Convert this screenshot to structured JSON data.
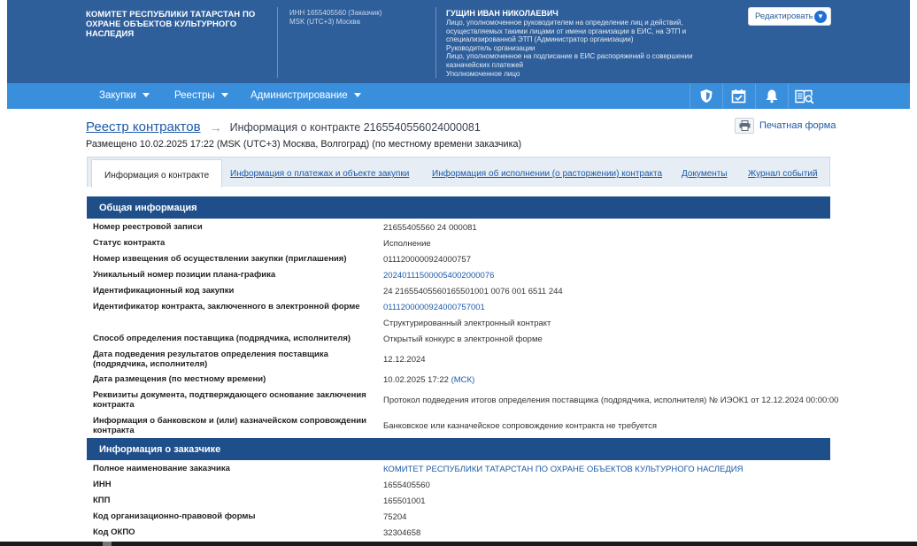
{
  "header": {
    "org_name": "КОМИТЕТ РЕСПУБЛИКИ ТАТАРСТАН ПО ОХРАНЕ ОБЪЕКТОВ КУЛЬТУРНОГО НАСЛЕДИЯ",
    "inn_line": "ИНН 1655405560 (Заказчик)",
    "tz_line": "MSK (UTC+3) Москва",
    "user_name": "ГУЩИН ИВАН НИКОЛАЕВИЧ",
    "user_roles": [
      "Лицо, уполномоченное руководителем на определение лиц и действий, осуществляемых такими лицами от имени организации в ЕИС, на ЭТП и специализированной ЭТП (Администратор организации)",
      "Руководитель организации",
      "Лицо, уполномоченное на подписание в ЕИС распоряжений о совершении казначейских платежей",
      "Уполномоченное лицо"
    ],
    "edit_label": "Редактировать"
  },
  "nav": {
    "items": [
      {
        "label": "Закупки"
      },
      {
        "label": "Реестры"
      },
      {
        "label": "Администрирование"
      }
    ],
    "icons": [
      "shield-icon",
      "calendar-check-icon",
      "bell-icon",
      "book-search-icon"
    ]
  },
  "breadcrumb": {
    "root": "Реестр контрактов",
    "current": "Информация о контракте 2165540556024000081"
  },
  "posted_text": "Размещено 10.02.2025 17:22 (MSK (UTC+3) Москва, Волгоград) (по местному времени заказчика)",
  "print_label": "Печатная форма",
  "tabs": [
    {
      "label": "Информация о контракте"
    },
    {
      "label": "Информация о платежах и объекте закупки"
    },
    {
      "label": "Информация об исполнении (о расторжении) контракта"
    },
    {
      "label": "Документы"
    },
    {
      "label": "Журнал событий"
    }
  ],
  "general": {
    "title": "Общая информация",
    "rows": [
      {
        "label": "Номер реестровой записи",
        "value": "21655405560 24 000081"
      },
      {
        "label": "Статус контракта",
        "value": "Исполнение"
      },
      {
        "label": "Номер извещения об осуществлении закупки (приглашения)",
        "value": "0111200000924000757"
      },
      {
        "label": "Уникальный номер позиции плана-графика",
        "value": "202401115000054002000076"
      },
      {
        "label": "Идентификационный код закупки",
        "value": "24 21655405560165501001 0076 001 6511 244"
      },
      {
        "label": "Идентификатор контракта, заключенного в электронной форме",
        "value": "0111200000924000757001",
        "value2": "Структурированный электронный контракт"
      },
      {
        "label": "Способ определения поставщика (подрядчика, исполнителя)",
        "value": "Открытый конкурс в электронной форме"
      },
      {
        "label": "Дата подведения результатов определения поставщика (подрядчика, исполнителя)",
        "value": "12.12.2024"
      },
      {
        "label": "Дата размещения (по местному времени)",
        "value": "10.02.2025 17:22",
        "suffix": "(МСК)"
      },
      {
        "label": "Реквизиты документа, подтверждающего основание заключения контракта",
        "value": "Протокол подведения итогов определения поставщика (подрядчика, исполнителя) № ИЭОК1 от 12.12.2024 00:00:00"
      },
      {
        "label": "Информация о банковском и (или) казначейском сопровождении контракта",
        "value": "Банковское или казначейское сопровождение контракта не требуется"
      }
    ]
  },
  "customer": {
    "title": "Информация о заказчике",
    "rows": [
      {
        "label": "Полное наименование заказчика",
        "value": "КОМИТЕТ РЕСПУБЛИКИ ТАТАРСТАН ПО ОХРАНЕ ОБЪЕКТОВ КУЛЬТУРНОГО НАСЛЕДИЯ"
      },
      {
        "label": "ИНН",
        "value": "1655405560"
      },
      {
        "label": "КПП",
        "value": "165501001"
      },
      {
        "label": "Код организационно-правовой формы",
        "value": "75204"
      },
      {
        "label": "Код ОКПО",
        "value": "32304658"
      }
    ]
  },
  "colors": {
    "header_bg": "#2f5f9b",
    "nav_bg": "#3a8fdc",
    "section_bg": "#1f4f8a",
    "link": "#1d5aa8"
  }
}
